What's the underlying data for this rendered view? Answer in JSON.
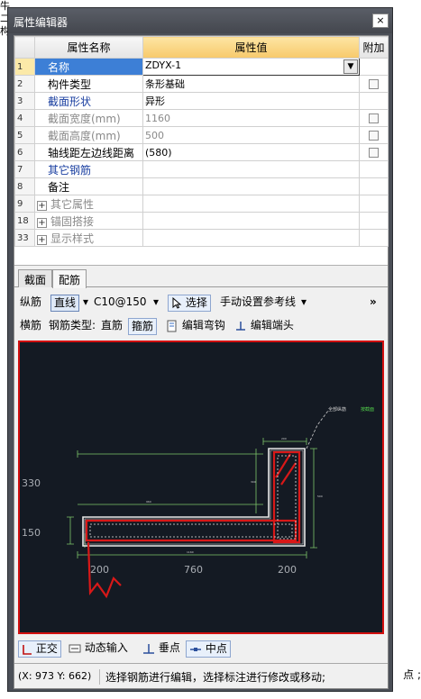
{
  "background": {
    "left_top": "牛二",
    "left_mid": "构",
    "right_bottom": "点 ;"
  },
  "window": {
    "title": "属性编辑器",
    "close": "×"
  },
  "grid": {
    "headers": {
      "name": "属性名称",
      "value": "属性值",
      "add": "附加"
    },
    "rows": [
      {
        "idx": "1",
        "name": "名称",
        "value": "ZDYX-1",
        "style": "selected",
        "check": false,
        "dropdown": true
      },
      {
        "idx": "2",
        "name": "构件类型",
        "value": "条形基础",
        "style": "dark",
        "check": true
      },
      {
        "idx": "3",
        "name": "截面形状",
        "value": "异形",
        "style": "blue",
        "check": false
      },
      {
        "idx": "4",
        "name": "截面宽度(mm)",
        "value": "1160",
        "style": "gray",
        "check": true
      },
      {
        "idx": "5",
        "name": "截面高度(mm)",
        "value": "500",
        "style": "gray",
        "check": true
      },
      {
        "idx": "6",
        "name": "轴线距左边线距离",
        "value": "(580)",
        "style": "dark",
        "check": true
      },
      {
        "idx": "7",
        "name": "其它钢筋",
        "value": "",
        "style": "blue",
        "check": false
      },
      {
        "idx": "8",
        "name": "备注",
        "value": "",
        "style": "dark",
        "check": false
      },
      {
        "idx": "9",
        "name": "其它属性",
        "value": "",
        "style": "group",
        "check": false
      },
      {
        "idx": "18",
        "name": "锚固搭接",
        "value": "",
        "style": "group",
        "check": false
      },
      {
        "idx": "33",
        "name": "显示样式",
        "value": "",
        "style": "group",
        "check": false
      }
    ],
    "expand_symbol": "+"
  },
  "tabs": [
    {
      "label": "截面"
    },
    {
      "label": "配筋"
    }
  ],
  "toolbar1": {
    "longitudinal": "纵筋",
    "line": "直线",
    "line_arrow": "▾",
    "rebar": "C10@150",
    "rebar_arrow": "▾",
    "select": "选择",
    "manual_ref": "手动设置参考线",
    "manual_arrow": "▾",
    "more": "»"
  },
  "toolbar2": {
    "transverse": "横筋",
    "rebar_type_label": "钢筋类型:",
    "straight": "直筋",
    "stirrup": "箍筋",
    "edit_hook": "编辑弯钩",
    "edit_end": "编辑端头"
  },
  "canvas": {
    "labels": {
      "all_rebar": "全部纵筋",
      "by_hook": "按截面",
      "dim_330": "330",
      "dim_150": "150",
      "dim_200_left": "200",
      "dim_760": "760",
      "dim_200_right": "200"
    }
  },
  "bottom": {
    "ortho": "正交",
    "dynamic_input": "动态输入",
    "perpendicular": "垂点",
    "midpoint": "中点"
  },
  "status": {
    "coord": "(X: 973 Y: 662)",
    "message": "选择钢筋进行编辑，选择标注进行修改或移动;"
  },
  "colors": {
    "canvas_bg": "#141a23",
    "canvas_border": "#d21010",
    "rebar_red": "#d81818",
    "dim_green": "#7cc46a",
    "section_white": "#e8e8e8"
  }
}
